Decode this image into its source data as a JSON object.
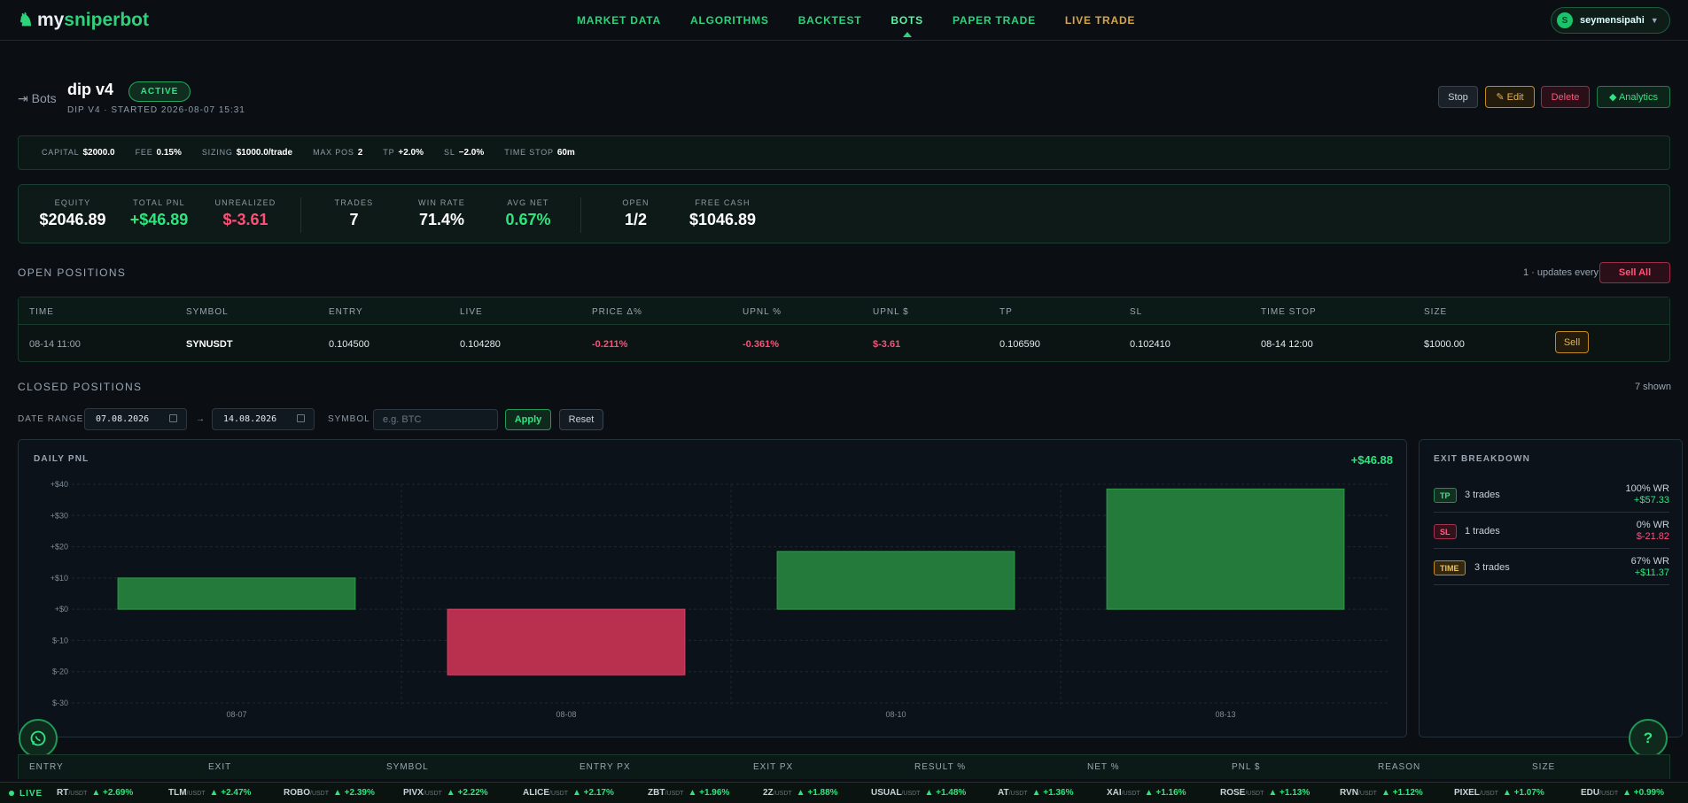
{
  "brand": {
    "prefix": "my",
    "highlight": "sniperbot"
  },
  "nav": {
    "items": [
      {
        "label": "MARKET DATA",
        "name": "nav-market-data"
      },
      {
        "label": "ALGORITHMS",
        "name": "nav-algorithms"
      },
      {
        "label": "BACKTEST",
        "name": "nav-backtest"
      },
      {
        "label": "BOTS",
        "name": "nav-bots",
        "active": true
      },
      {
        "label": "PAPER TRADE",
        "name": "nav-paper-trade"
      },
      {
        "label": "LIVE TRADE",
        "name": "nav-live-trade",
        "live": true
      }
    ],
    "user": {
      "initial": "S",
      "name": "seymensipahi"
    }
  },
  "header": {
    "back_label": "Bots",
    "bot_name": "dip v4",
    "status": "ACTIVE",
    "subtitle": "DIP V4 · STARTED 2026-08-07 15:31",
    "actions": {
      "stop": "Stop",
      "edit": "✎ Edit",
      "delete": "Delete",
      "analytics": "◆ Analytics"
    }
  },
  "config": [
    {
      "label": "CAPITAL",
      "value": "$2000.0"
    },
    {
      "label": "FEE",
      "value": "0.15%"
    },
    {
      "label": "SIZING",
      "value": "$1000.0/trade"
    },
    {
      "label": "MAX POS",
      "value": "2"
    },
    {
      "label": "TP",
      "value": "+2.0%"
    },
    {
      "label": "SL",
      "value": "−2.0%"
    },
    {
      "label": "TIME STOP",
      "value": "60m"
    }
  ],
  "stats": {
    "equity": {
      "label": "EQUITY",
      "value": "$2046.89"
    },
    "total_pnl": {
      "label": "TOTAL PNL",
      "value": "+$46.89"
    },
    "unrealized": {
      "label": "UNREALIZED",
      "value": "$-3.61"
    },
    "trades": {
      "label": "TRADES",
      "value": "7"
    },
    "win_rate": {
      "label": "WIN RATE",
      "value": "71.4%"
    },
    "avg_net": {
      "label": "AVG NET",
      "value": "0.67%"
    },
    "open": {
      "label": "OPEN",
      "value": "1/2"
    },
    "free_cash": {
      "label": "FREE CASH",
      "value": "$1046.89"
    }
  },
  "open_positions": {
    "title": "OPEN POSITIONS",
    "updates": "1 · updates every 1s",
    "sell_all": "Sell All",
    "columns": [
      "TIME",
      "SYMBOL",
      "ENTRY",
      "LIVE",
      "PRICE Δ%",
      "UPNL %",
      "UPNL $",
      "TP",
      "SL",
      "TIME STOP",
      "SIZE"
    ],
    "row": {
      "time": "08-14 11:00",
      "symbol": "SYNUSDT",
      "entry": "0.104500",
      "live": "0.104280",
      "price_delta": "-0.211%",
      "upnl_pct": "-0.361%",
      "upnl_usd": "$-3.61",
      "tp": "0.106590",
      "sl": "0.102410",
      "time_stop": "08-14 12:00",
      "size": "$1000.00",
      "sell": "Sell"
    }
  },
  "closed_positions": {
    "title": "CLOSED POSITIONS",
    "shown": "7 shown",
    "filters": {
      "date_label": "DATE RANGE",
      "from": "07.08.2026",
      "arrow": "→",
      "to": "14.08.2026",
      "symbol_label": "SYMBOL",
      "symbol_placeholder": "e.g. BTC",
      "apply": "Apply",
      "reset": "Reset"
    },
    "columns": [
      "ENTRY",
      "EXIT",
      "SYMBOL",
      "ENTRY PX",
      "EXIT PX",
      "RESULT %",
      "NET %",
      "PNL $",
      "REASON",
      "SIZE"
    ]
  },
  "chart_data": {
    "type": "bar",
    "title": "DAILY PNL",
    "total_label": "+$46.88",
    "categories": [
      "08-07",
      "08-08",
      "08-10",
      "08-13"
    ],
    "values": [
      10,
      -21,
      18.5,
      38.5
    ],
    "ylim": [
      -30,
      40
    ],
    "yticks": [
      "+$40",
      "+$30",
      "+$20",
      "+$10",
      "+$0",
      "$-10",
      "$-20",
      "$-30"
    ],
    "colors": {
      "positive": "#237a3a",
      "negative": "#b8304e"
    }
  },
  "exit_breakdown": {
    "title": "EXIT BREAKDOWN",
    "rows": [
      {
        "tag": "TP",
        "trades": "3 trades",
        "wr": "100% WR",
        "pnl": "+$57.33"
      },
      {
        "tag": "SL",
        "trades": "1 trades",
        "wr": "0% WR",
        "pnl": "$-21.82"
      },
      {
        "tag": "TIME",
        "trades": "3 trades",
        "wr": "67% WR",
        "pnl": "+$11.37"
      }
    ]
  },
  "ticker": {
    "live_label": "LIVE",
    "items": [
      {
        "sym": "RT",
        "q": "/USDT",
        "chg": "▲ +2.69%"
      },
      {
        "sym": "TLM",
        "q": "/USDT",
        "chg": "▲ +2.47%"
      },
      {
        "sym": "ROBO",
        "q": "/USDT",
        "chg": "▲ +2.39%"
      },
      {
        "sym": "PIVX",
        "q": "/USDT",
        "chg": "▲ +2.22%"
      },
      {
        "sym": "ALICE",
        "q": "/USDT",
        "chg": "▲ +2.17%"
      },
      {
        "sym": "ZBT",
        "q": "/USDT",
        "chg": "▲ +1.96%"
      },
      {
        "sym": "2Z",
        "q": "/USDT",
        "chg": "▲ +1.88%"
      },
      {
        "sym": "USUAL",
        "q": "/USDT",
        "chg": "▲ +1.48%"
      },
      {
        "sym": "AT",
        "q": "/USDT",
        "chg": "▲ +1.36%"
      },
      {
        "sym": "XAI",
        "q": "/USDT",
        "chg": "▲ +1.16%"
      },
      {
        "sym": "ROSE",
        "q": "/USDT",
        "chg": "▲ +1.13%"
      },
      {
        "sym": "RVN",
        "q": "/USDT",
        "chg": "▲ +1.12%"
      },
      {
        "sym": "PIXEL",
        "q": "/USDT",
        "chg": "▲ +1.07%"
      },
      {
        "sym": "EDU",
        "q": "/USDT",
        "chg": "▲ +0.99%"
      }
    ]
  },
  "fabs": {
    "help": "?"
  }
}
